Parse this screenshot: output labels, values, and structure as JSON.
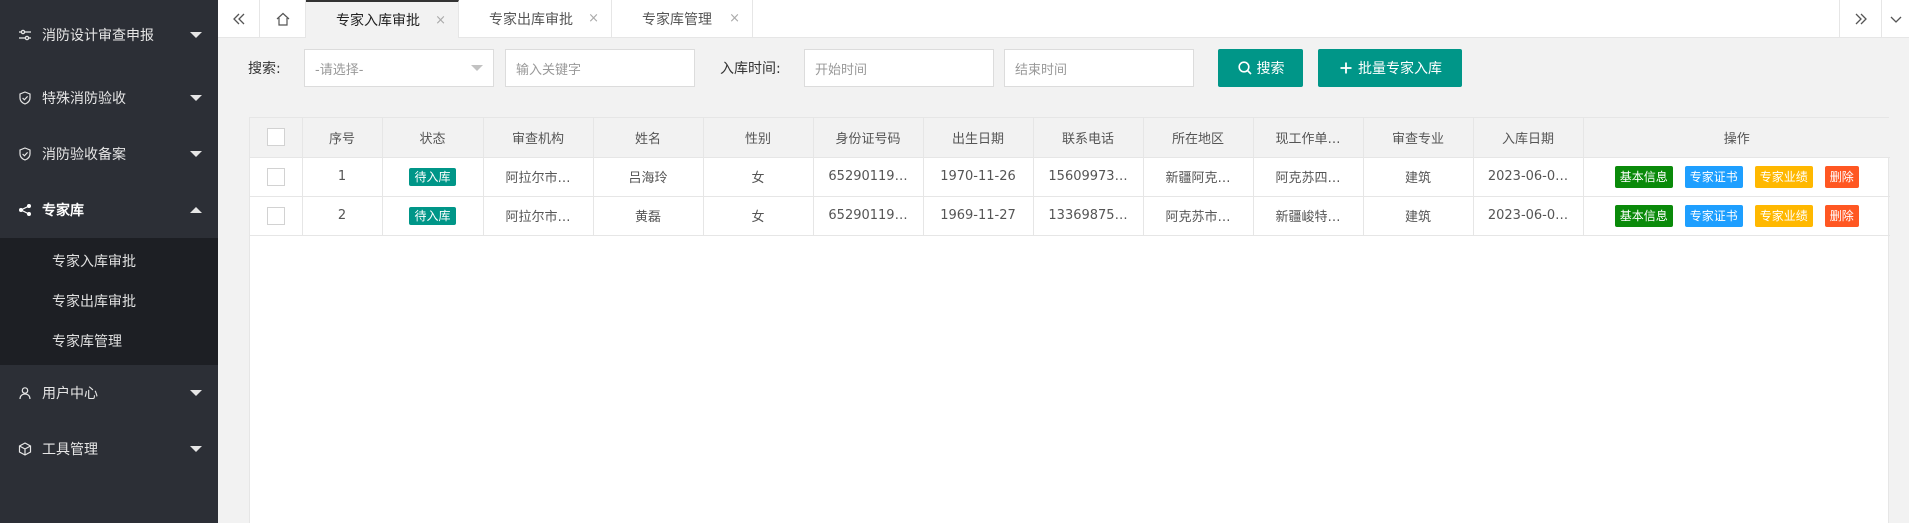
{
  "sidebar": {
    "menu": [
      {
        "label": "消防设计审查申报"
      },
      {
        "label": "特殊消防验收"
      },
      {
        "label": "消防验收备案"
      },
      {
        "label": "专家库"
      },
      {
        "label": "用户中心"
      },
      {
        "label": "工具管理"
      }
    ],
    "submenu": [
      {
        "label": "专家入库审批"
      },
      {
        "label": "专家出库审批"
      },
      {
        "label": "专家库管理"
      }
    ]
  },
  "tabs": [
    {
      "label": "专家入库审批",
      "close": "×"
    },
    {
      "label": "专家出库审批",
      "close": "×"
    },
    {
      "label": "专家库管理",
      "close": "×"
    }
  ],
  "search": {
    "label": "搜索:",
    "select_value": "-请选择-",
    "keyword_placeholder": "输入关键字",
    "time_label": "入库时间:",
    "start_placeholder": "开始时间",
    "end_placeholder": "结束时间",
    "search_button": "搜索",
    "batch_button": "批量专家入库"
  },
  "table": {
    "headers": [
      "序号",
      "状态",
      "审查机构",
      "姓名",
      "性别",
      "身份证号码",
      "出生日期",
      "联系电话",
      "所在地区",
      "现工作单…",
      "审查专业",
      "入库日期",
      "操作"
    ],
    "rows": [
      {
        "no": "1",
        "status": "待入库",
        "org": "阿拉尔市…",
        "name": "吕海玲",
        "gender": "女",
        "id_no": "65290119…",
        "birth": "1970-11-26",
        "phone": "15609973…",
        "region": "新疆阿克…",
        "work": "阿克苏四…",
        "major": "建筑",
        "date": "2023-06-0…"
      },
      {
        "no": "2",
        "status": "待入库",
        "org": "阿拉尔市…",
        "name": "黄磊",
        "gender": "女",
        "id_no": "65290119…",
        "birth": "1969-11-27",
        "phone": "13369875…",
        "region": "阿克苏市…",
        "work": "新疆峻特…",
        "major": "建筑",
        "date": "2023-06-0…"
      }
    ],
    "ops": [
      {
        "label": "基本信息",
        "color": "#0a8a0a"
      },
      {
        "label": "专家证书",
        "color": "#1e9fff"
      },
      {
        "label": "专家业绩",
        "color": "#ffb800"
      },
      {
        "label": "删除",
        "color": "#ff5722"
      }
    ]
  },
  "colors": {
    "sidebar_bg": "#2c2f36",
    "submenu_bg": "#1d1f24",
    "accent": "#009688"
  }
}
